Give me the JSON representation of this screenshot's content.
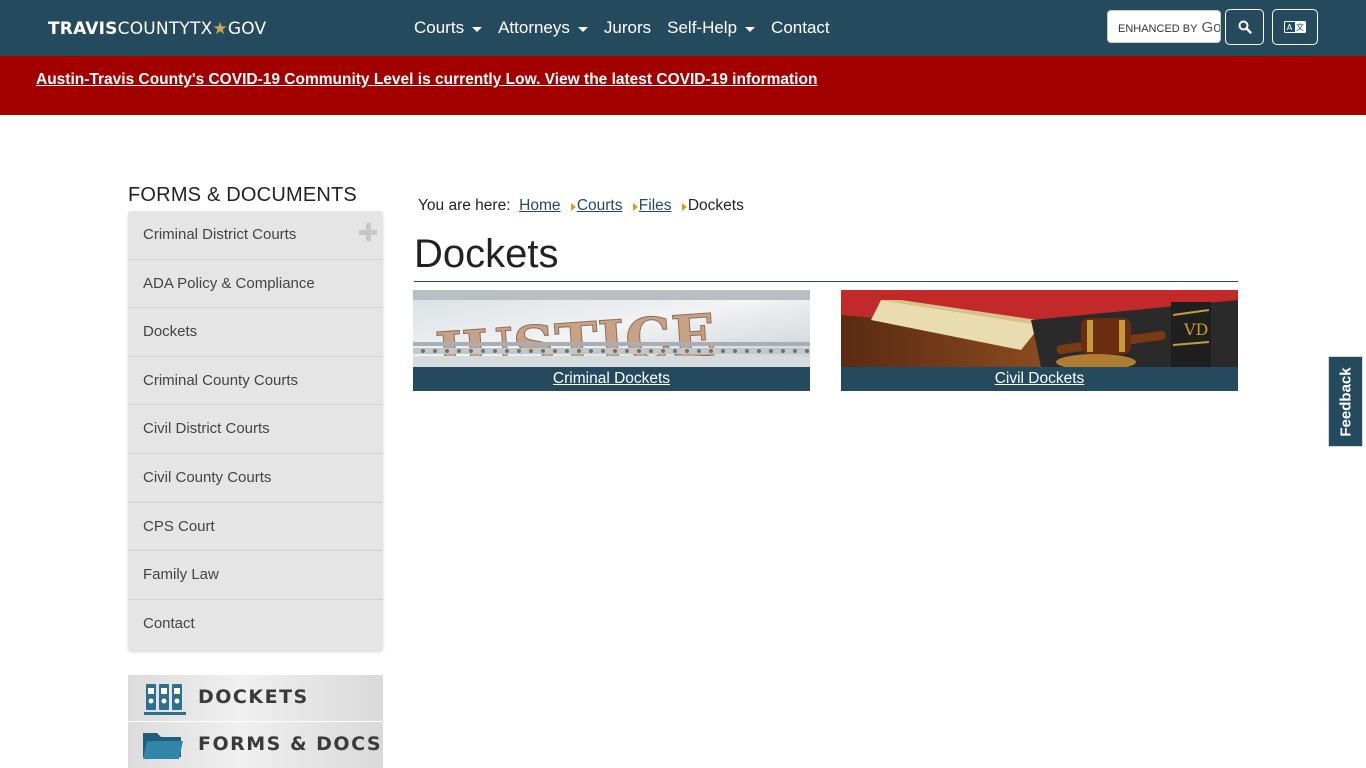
{
  "header": {
    "logo": {
      "part1": "TRAVIS",
      "part2": "COUNTY",
      "part3": "TX",
      "star": "★",
      "part4": "GOV"
    },
    "nav": [
      {
        "label": "Courts",
        "dropdown": true
      },
      {
        "label": "Attorneys",
        "dropdown": true
      },
      {
        "label": "Jurors",
        "dropdown": false
      },
      {
        "label": "Self-Help",
        "dropdown": true
      },
      {
        "label": "Contact",
        "dropdown": false
      }
    ],
    "search_placeholder": "ENHANCED BY",
    "search_brand": "Go",
    "search_icon": "magnifier-icon",
    "language_icon": "translate-icon"
  },
  "alert": {
    "text": "Austin-Travis County's COVID-19 Community Level is currently Low. View the latest COVID-19 information",
    "background": "#a30000"
  },
  "sidebar": {
    "title": "FORMS & DOCUMENTS",
    "items": [
      {
        "label": "Criminal District Courts",
        "expandable": true
      },
      {
        "label": "ADA Policy & Compliance"
      },
      {
        "label": "Dockets"
      },
      {
        "label": "Criminal County Courts"
      },
      {
        "label": "Civil District Courts"
      },
      {
        "label": "Civil County Courts"
      },
      {
        "label": "CPS Court"
      },
      {
        "label": "Family Law"
      },
      {
        "label": "Contact"
      }
    ],
    "promos": [
      {
        "label": "DOCKETS",
        "icon": "binders-icon"
      },
      {
        "label": "FORMS & DOCS",
        "icon": "folder-icon"
      }
    ]
  },
  "breadcrumb": {
    "prefix": "You are here:",
    "links": [
      "Home",
      "Courts",
      "Files"
    ],
    "current": "Dockets"
  },
  "main": {
    "title": "Dockets",
    "cards": [
      {
        "label": "Criminal Dockets",
        "image": "justice-engraving"
      },
      {
        "label": "Civil Dockets",
        "image": "law-book-and-gavel"
      }
    ]
  },
  "feedback": {
    "label": "Feedback"
  },
  "colors": {
    "primary": "#254a5d",
    "alert": "#a30000",
    "accent": "#d4a017"
  }
}
